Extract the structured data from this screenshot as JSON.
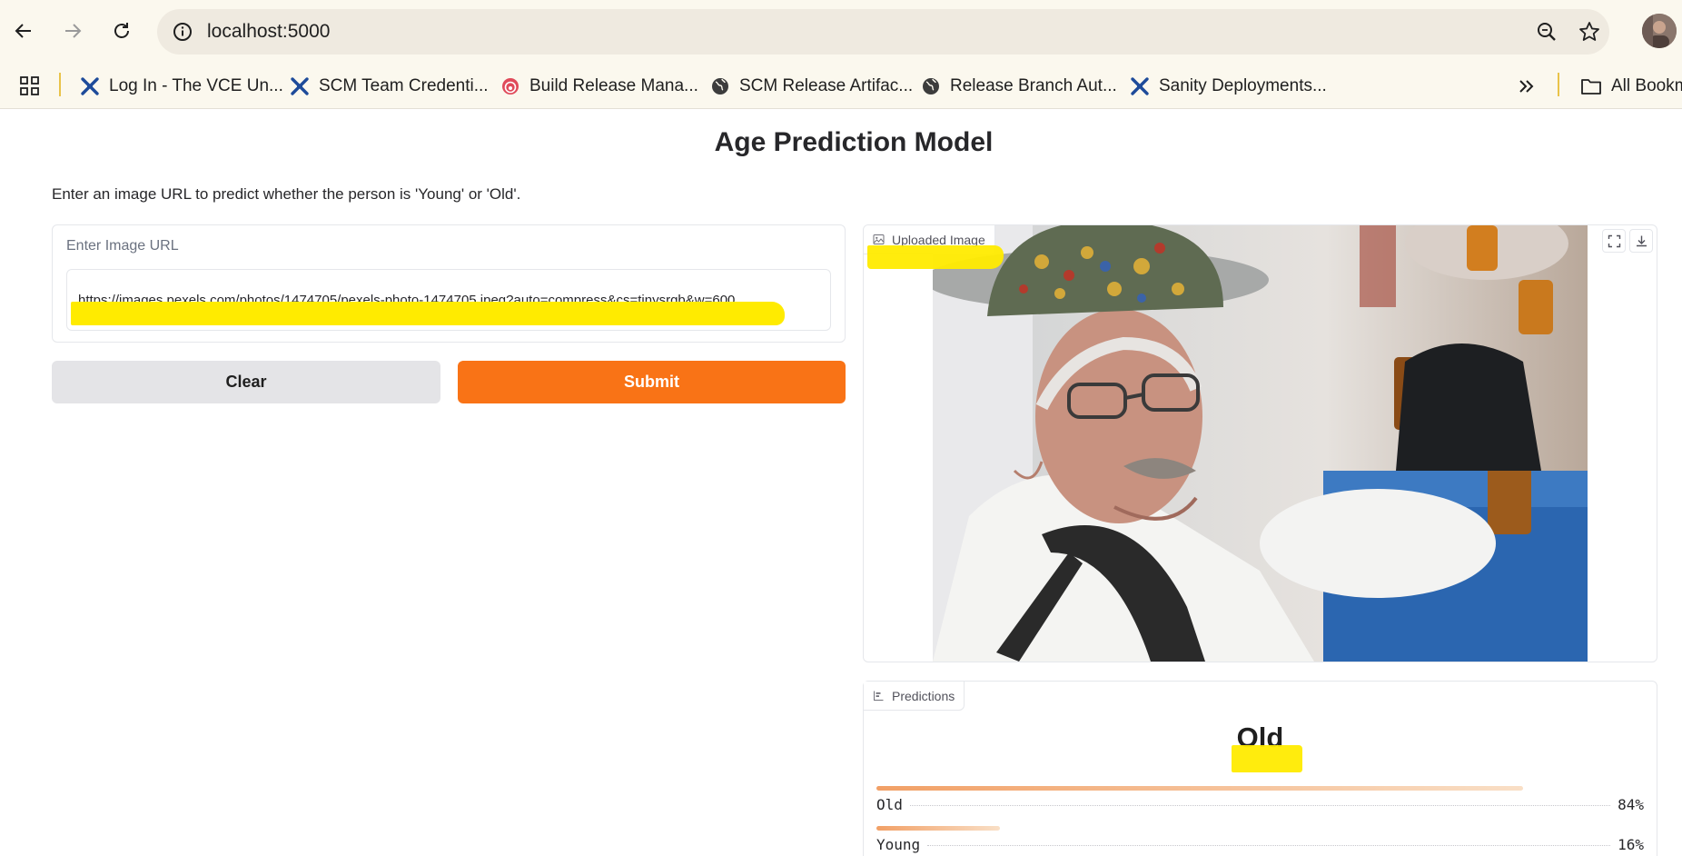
{
  "browser": {
    "url": "localhost:5000",
    "bookmarks": [
      {
        "label": "Log In - The VCE Un...",
        "icon": "vce-logo-icon"
      },
      {
        "label": "SCM Team Credenti...",
        "icon": "vce-logo-icon"
      },
      {
        "label": "Build Release Mana...",
        "icon": "target-icon"
      },
      {
        "label": "SCM Release Artifac...",
        "icon": "globe-icon"
      },
      {
        "label": "Release Branch Aut...",
        "icon": "globe-icon"
      },
      {
        "label": "Sanity Deployments...",
        "icon": "vce-logo-icon"
      }
    ],
    "all_bookmarks": "All Bookm"
  },
  "page": {
    "title": "Age Prediction Model",
    "description": "Enter an image URL to predict whether the person is 'Young' or 'Old'."
  },
  "input": {
    "label": "Enter Image URL",
    "value": "https://images.pexels.com/photos/1474705/pexels-photo-1474705.jpeg?auto=compress&cs=tinysrgb&w=600"
  },
  "buttons": {
    "clear": "Clear",
    "submit": "Submit"
  },
  "image_panel": {
    "label": "Uploaded Image"
  },
  "predictions": {
    "label": "Predictions",
    "top_label": "Old",
    "items": [
      {
        "label": "Old",
        "percent": "84%",
        "value": 0.84
      },
      {
        "label": "Young",
        "percent": "16%",
        "value": 0.16
      }
    ]
  },
  "colors": {
    "accent": "#f97316",
    "highlight": "#ffeb00"
  }
}
